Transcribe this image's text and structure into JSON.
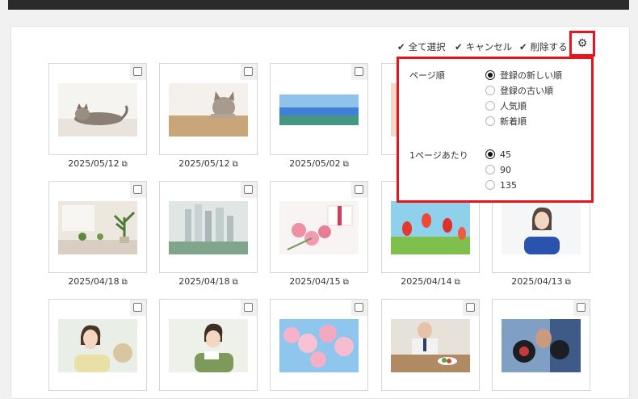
{
  "toolbar": {
    "select_all": "全て選択",
    "cancel": "キャンセル",
    "delete": "削除する",
    "check_icon": "check-icon",
    "settings_icon": "gear-icon"
  },
  "settings": {
    "order_label": "ページ順",
    "order_options": [
      "登録の新しい順",
      "登録の古い順",
      "人気順",
      "新着順"
    ],
    "order_selected": "登録の新しい順",
    "per_page_label": "1ページあたり",
    "per_page_options": [
      "45",
      "90",
      "135"
    ],
    "per_page_selected": "45"
  },
  "grid": {
    "rows": [
      {
        "dates": [
          "2025/05/12",
          "2025/05/12",
          "2025/05/02",
          "",
          ""
        ]
      },
      {
        "dates": [
          "2025/04/18",
          "2025/04/18",
          "2025/04/15",
          "2025/04/14",
          "2025/04/13"
        ]
      },
      {
        "dates": [
          "",
          "",
          "",
          "",
          ""
        ]
      }
    ],
    "external_link_icon": "external-link-icon"
  },
  "colors": {
    "highlight": "#e8141b",
    "topbar": "#2b2b2b"
  }
}
